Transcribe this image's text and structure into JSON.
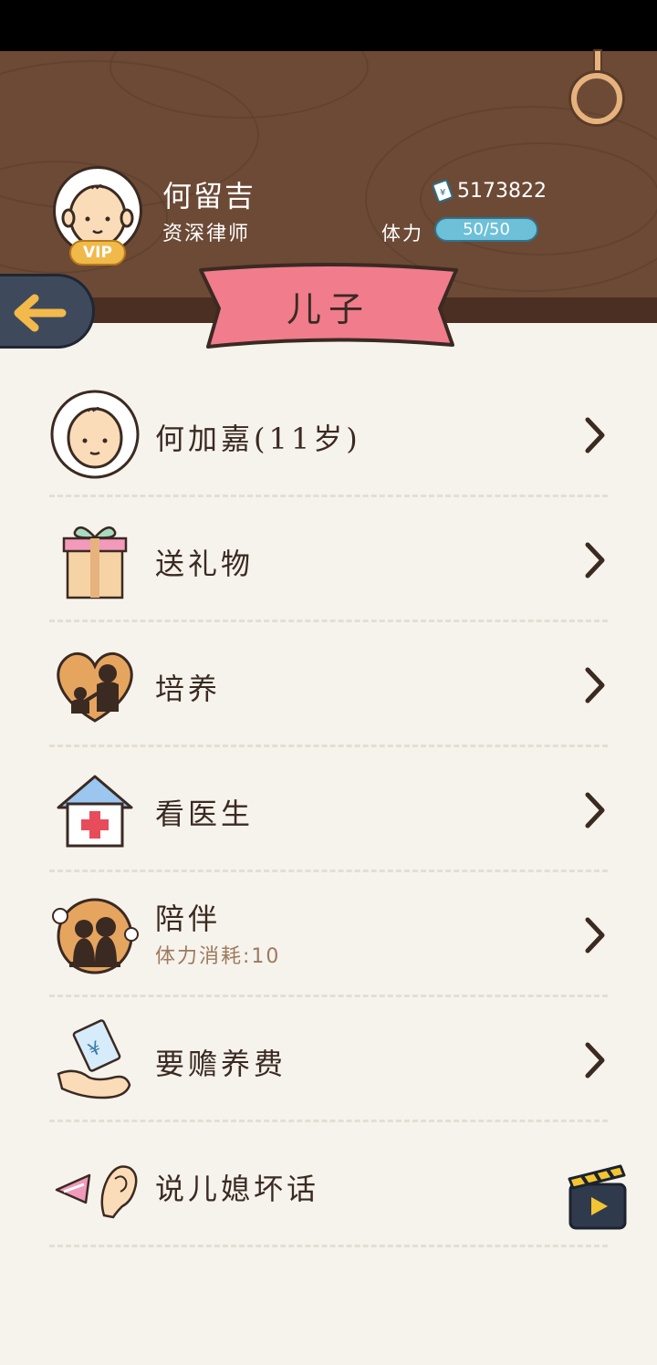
{
  "header": {
    "user_name": "何留吉",
    "user_title": "资深律师",
    "vip_label": "VIP",
    "money": "5173822",
    "stamina_label": "体力",
    "stamina": "50/50"
  },
  "page_title": "儿子",
  "colors": {
    "wood": "#6d4a36",
    "banner": "#f07c8c",
    "stamina": "#6cc0d8",
    "background": "#f6f3ec"
  },
  "menu": [
    {
      "label": "何加嘉(11岁)",
      "icon": "child-avatar-icon"
    },
    {
      "label": "送礼物",
      "icon": "gift-icon"
    },
    {
      "label": "培养",
      "icon": "heart-parent-child-icon"
    },
    {
      "label": "看医生",
      "icon": "hospital-icon"
    },
    {
      "label": "陪伴",
      "sub": "体力消耗:10",
      "icon": "family-companion-icon"
    },
    {
      "label": "要赡养费",
      "icon": "money-hand-icon"
    },
    {
      "label": "说儿媳坏话",
      "icon": "gossip-ear-icon",
      "action_icon": "video-ad-icon"
    }
  ]
}
